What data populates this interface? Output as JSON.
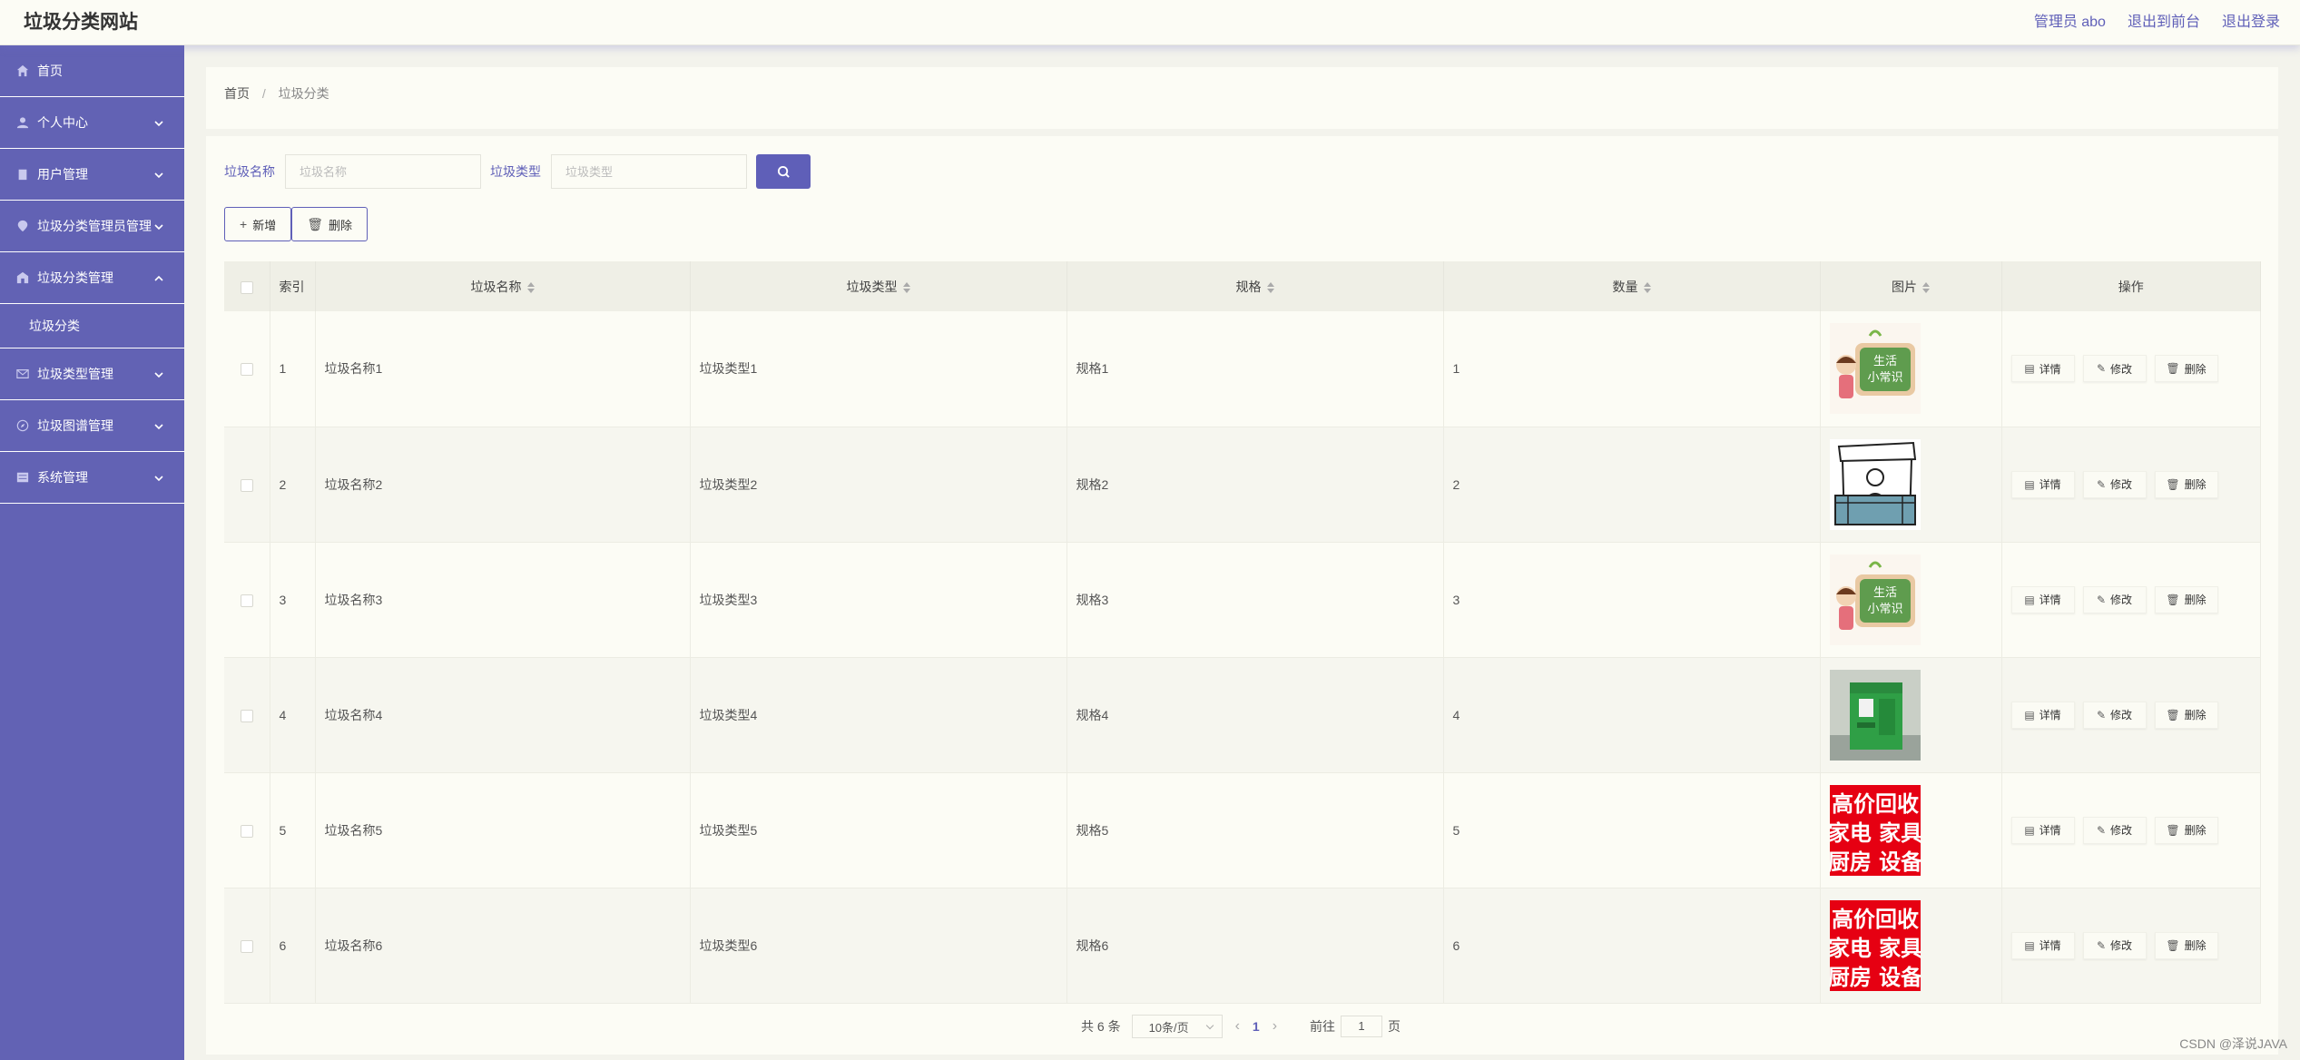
{
  "header": {
    "title": "垃圾分类网站",
    "admin_label": "管理员 abo",
    "to_front": "退出到前台",
    "logout": "退出登录"
  },
  "sidebar": {
    "items": [
      {
        "label": "首页",
        "icon": "home-icon"
      },
      {
        "label": "个人中心",
        "icon": "user-icon"
      },
      {
        "label": "用户管理",
        "icon": "clipboard-icon"
      },
      {
        "label": "垃圾分类管理员管理",
        "icon": "location-icon"
      },
      {
        "label": "垃圾分类管理",
        "icon": "building-icon"
      },
      {
        "label": "垃圾分类",
        "icon": ""
      },
      {
        "label": "垃圾类型管理",
        "icon": "mail-icon"
      },
      {
        "label": "垃圾图谱管理",
        "icon": "compass-icon"
      },
      {
        "label": "系统管理",
        "icon": "grid-icon"
      }
    ]
  },
  "breadcrumb": {
    "home": "首页",
    "separator": "/",
    "current": "垃圾分类"
  },
  "search": {
    "name_label": "垃圾名称",
    "name_placeholder": "垃圾名称",
    "type_label": "垃圾类型",
    "type_placeholder": "垃圾类型"
  },
  "toolbar": {
    "add_label": "新增",
    "delete_label": "删除"
  },
  "table": {
    "headers": [
      "索引",
      "垃圾名称",
      "垃圾类型",
      "规格",
      "数量",
      "图片",
      "操作"
    ],
    "rows": [
      {
        "index": "1",
        "name": "垃圾名称1",
        "type": "垃圾类型1",
        "spec": "规格1",
        "qty": "1",
        "image": "poster-green-board"
      },
      {
        "index": "2",
        "name": "垃圾名称2",
        "type": "垃圾类型2",
        "spec": "规格2",
        "qty": "2",
        "image": "sketch-stall"
      },
      {
        "index": "3",
        "name": "垃圾名称3",
        "type": "垃圾类型3",
        "spec": "规格3",
        "qty": "3",
        "image": "poster-green-board"
      },
      {
        "index": "4",
        "name": "垃圾名称4",
        "type": "垃圾类型4",
        "spec": "规格4",
        "qty": "4",
        "image": "green-bin-photo"
      },
      {
        "index": "5",
        "name": "垃圾名称5",
        "type": "垃圾类型5",
        "spec": "规格5",
        "qty": "5",
        "image": "red-recycle-sign"
      },
      {
        "index": "6",
        "name": "垃圾名称6",
        "type": "垃圾类型6",
        "spec": "规格6",
        "qty": "6",
        "image": "red-recycle-sign"
      }
    ],
    "actions": {
      "detail": "详情",
      "edit": "修改",
      "delete": "删除"
    },
    "images": {
      "board_line1": "生活",
      "board_line2": "小常识",
      "sign_lines": [
        "高价回收",
        "家电 家具",
        "厨房 设备"
      ]
    }
  },
  "pager": {
    "total": "共 6 条",
    "page_size": "10条/页",
    "current_page": "1",
    "goto_label": "前往",
    "goto_value": "1",
    "page_suffix": "页"
  },
  "watermark": "CSDN @泽说JAVA"
}
